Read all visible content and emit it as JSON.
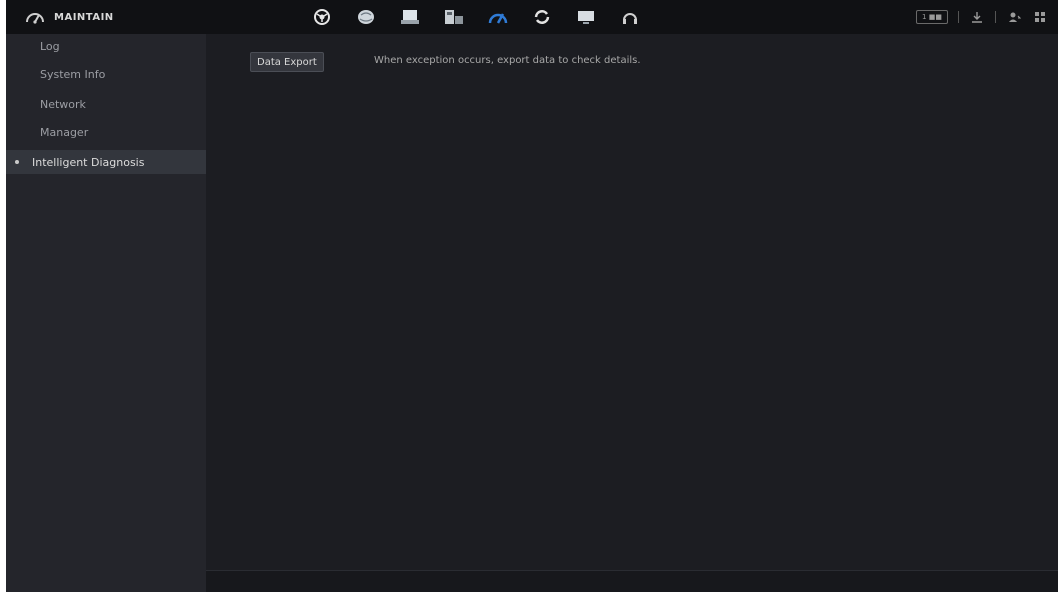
{
  "header": {
    "title": "MAINTAIN",
    "logo_icon": "gauge-icon",
    "nav_icons": [
      "live-view-icon",
      "ai-search-icon",
      "storage-icon",
      "display-icon",
      "maintain-icon",
      "backup-icon",
      "monitor-icon",
      "network-icon"
    ],
    "active_icon_index": 4,
    "controls": {
      "status_box": "1 ■■",
      "download_icon": "download-icon",
      "user_icon": "user-icon",
      "grid_icon": "grid-icon"
    }
  },
  "sidebar": {
    "items": [
      {
        "label": "Log"
      },
      {
        "label": "System Info"
      },
      {
        "label": "Network"
      },
      {
        "label": "Manager"
      },
      {
        "label": "Intelligent Diagnosis"
      }
    ],
    "active_index": 4
  },
  "main": {
    "export_button": "Data Export",
    "description": "When exception occurs, export data to check details."
  },
  "colors": {
    "background": "#1c1d22",
    "topbar": "#101114",
    "sidebar": "#24252b",
    "active_item": "#33363d",
    "accent_blue": "#2f7bd6"
  }
}
